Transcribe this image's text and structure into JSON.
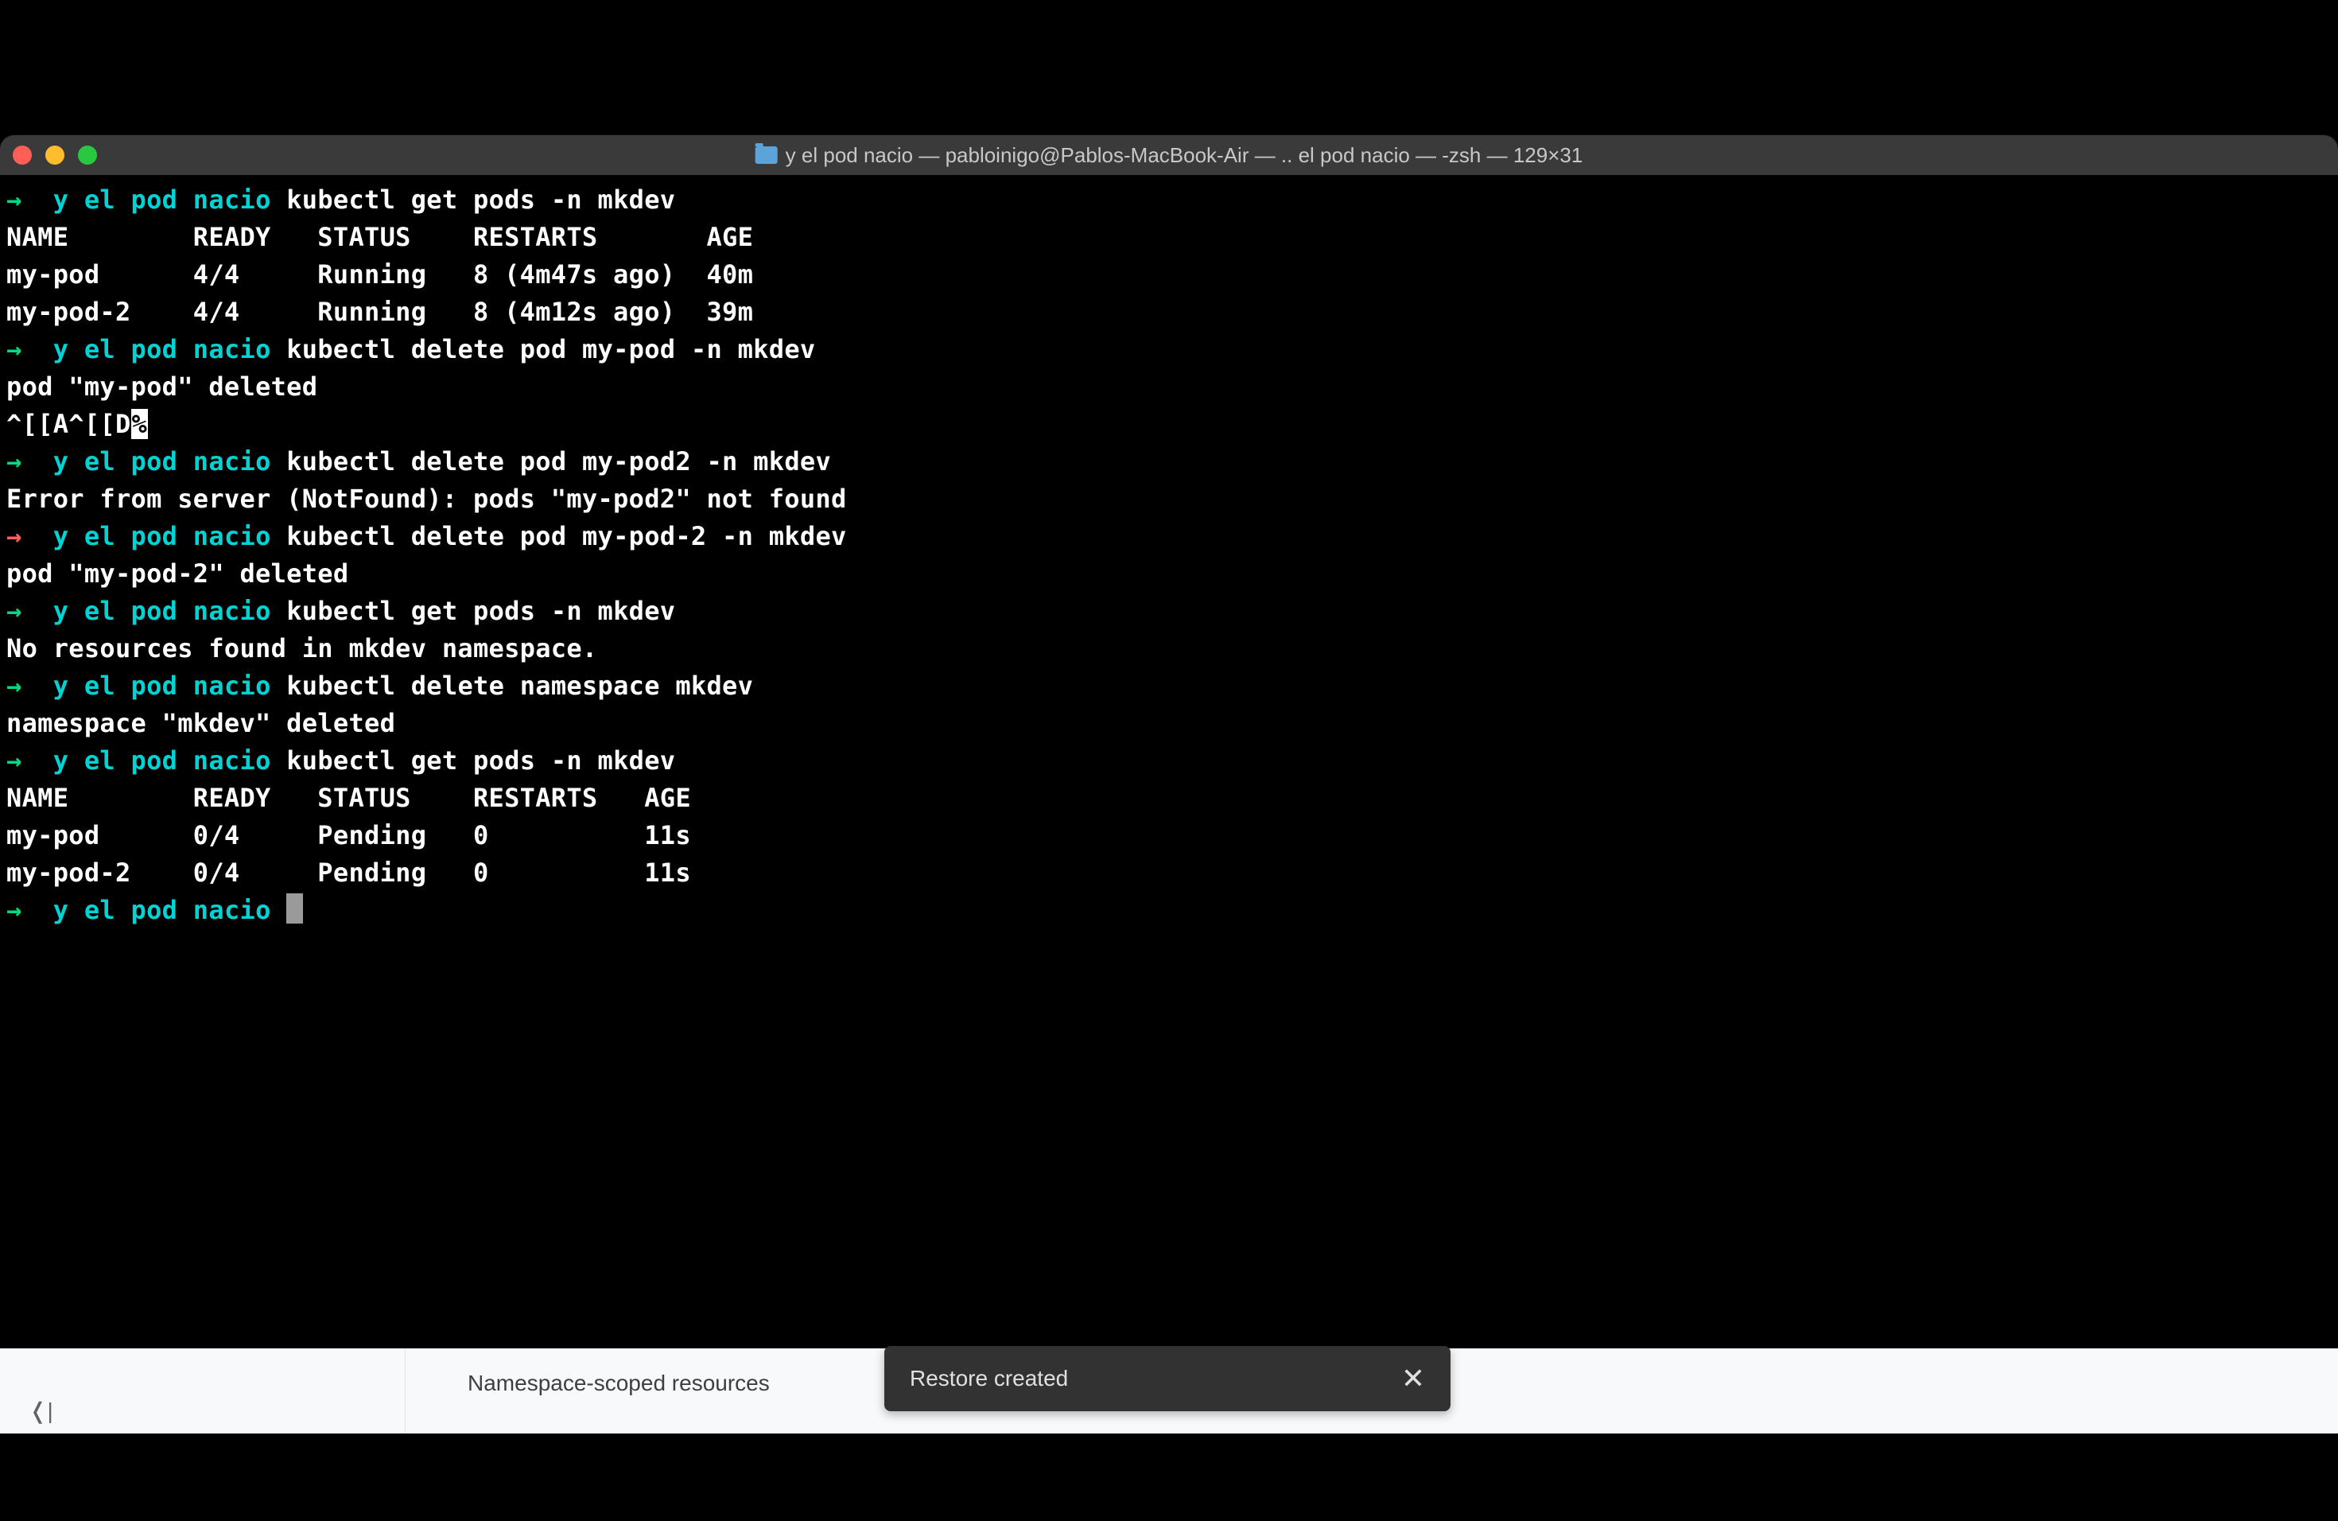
{
  "window": {
    "title": "y el pod nacio — pabloinigo@Pablos-MacBook-Air — .. el pod nacio — -zsh — 129×31"
  },
  "prompt": {
    "arrow": "→",
    "dir": "y el pod nacio"
  },
  "lines": {
    "cmd1": "kubectl get pods -n mkdev",
    "header1": "NAME        READY   STATUS    RESTARTS       AGE",
    "row1a": "my-pod      4/4     Running   8 (4m47s ago)  40m",
    "row1b": "my-pod-2    4/4     Running   8 (4m12s ago)  39m",
    "cmd2": "kubectl delete pod my-pod -n mkdev",
    "out2": "pod \"my-pod\" deleted",
    "garbage_a": "^[[A^[[D",
    "garbage_b": "%",
    "cmd3": "kubectl delete pod my-pod2 -n mkdev",
    "out3": "Error from server (NotFound): pods \"my-pod2\" not found",
    "cmd4": "kubectl delete pod my-pod-2 -n mkdev",
    "out4": "pod \"my-pod-2\" deleted",
    "cmd5": "kubectl get pods -n mkdev",
    "out5": "No resources found in mkdev namespace.",
    "cmd6": "kubectl delete namespace mkdev",
    "out6": "namespace \"mkdev\" deleted",
    "cmd7": "kubectl get pods -n mkdev",
    "header2": "NAME        READY   STATUS    RESTARTS   AGE",
    "row2a": "my-pod      0/4     Pending   0          11s",
    "row2b": "my-pod-2    0/4     Pending   0          11s"
  },
  "browser": {
    "sidebar_text": "Namespace-scoped resources"
  },
  "toast": {
    "message": "Restore created"
  }
}
